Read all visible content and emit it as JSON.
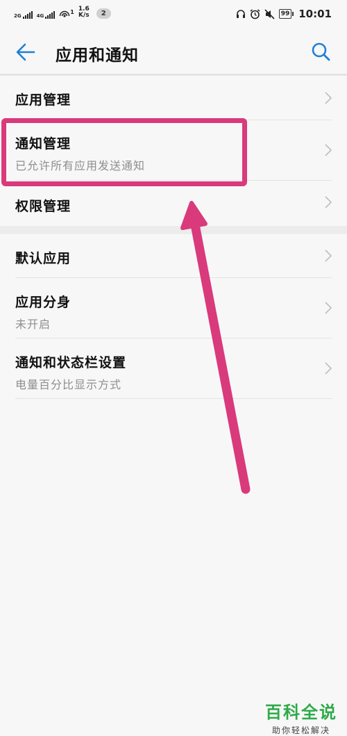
{
  "status_bar": {
    "sim1": "2G",
    "sim2": "4G",
    "hotspot_count": "1",
    "speed_value": "1.6",
    "speed_unit": "K/s",
    "notification_count": "2",
    "battery": "99",
    "time": "10:01",
    "icons": [
      "headphones-icon",
      "alarm-icon",
      "mute-icon"
    ]
  },
  "header": {
    "title": "应用和通知",
    "back_icon": "arrow-left-icon",
    "search_icon": "search-icon"
  },
  "group1": {
    "items": [
      {
        "title": "应用管理"
      },
      {
        "title": "通知管理",
        "subtitle": "已允许所有应用发送通知"
      },
      {
        "title": "权限管理"
      }
    ]
  },
  "group2": {
    "items": [
      {
        "title": "默认应用"
      },
      {
        "title": "应用分身",
        "subtitle": "未开启"
      },
      {
        "title": "通知和状态栏设置",
        "subtitle": "电量百分比显示方式"
      }
    ]
  },
  "annotation": {
    "color": "#d93a7c"
  },
  "watermark": {
    "title": "百科全说",
    "subtitle": "助你轻松解决"
  }
}
